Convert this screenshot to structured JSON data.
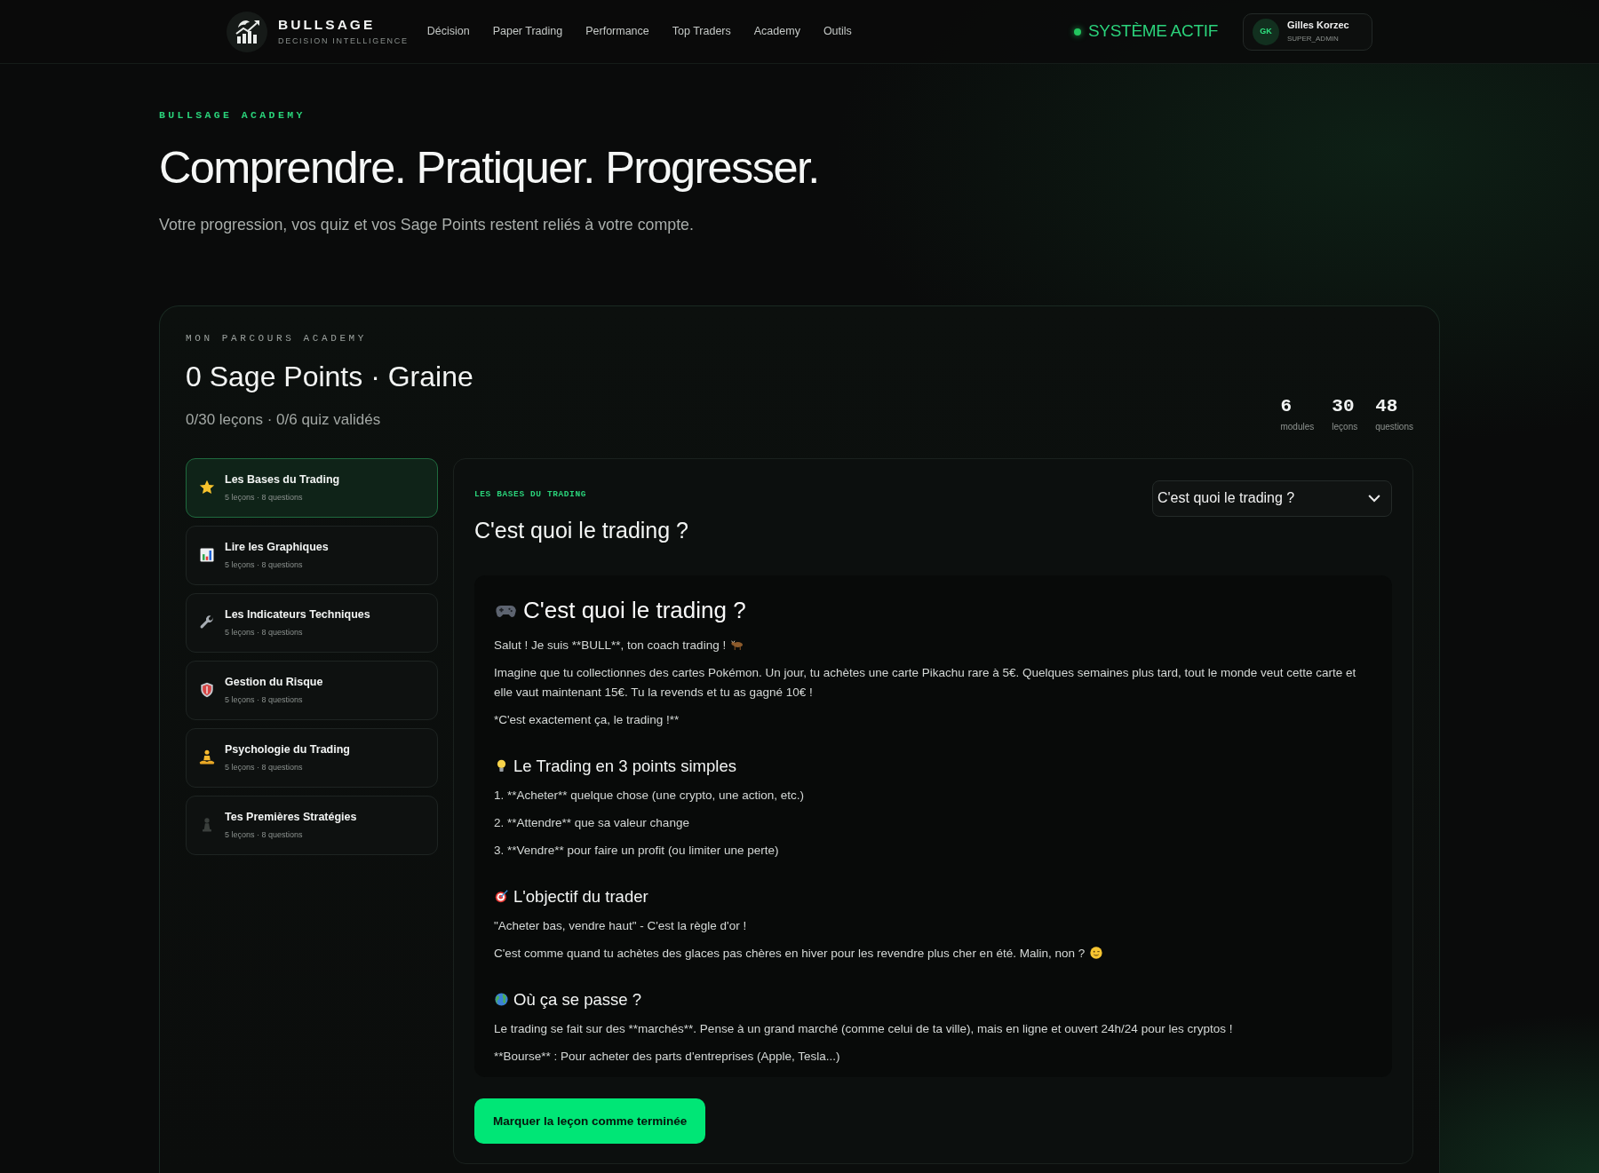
{
  "header": {
    "brand": {
      "name": "BULLSAGE",
      "tagline": "DECISION INTELLIGENCE"
    },
    "nav": [
      "Décision",
      "Paper Trading",
      "Performance",
      "Top Traders",
      "Academy",
      "Outils"
    ],
    "system_status": "SYSTÈME ACTIF",
    "user": {
      "initials": "GK",
      "name": "Gilles Korzec",
      "role": "SUPER_ADMIN"
    }
  },
  "hero": {
    "eyebrow": "BULLSAGE ACADEMY",
    "title": "Comprendre. Pratiquer. Progresser.",
    "subtitle": "Votre progression, vos quiz et vos Sage Points restent reliés à votre compte."
  },
  "journey": {
    "eyebrow": "MON PARCOURS ACADEMY",
    "title": "0 Sage Points · Graine",
    "progress": "0/30 leçons · 0/6 quiz validés",
    "stats": [
      {
        "value": "6",
        "label": "modules"
      },
      {
        "value": "30",
        "label": "leçons"
      },
      {
        "value": "48",
        "label": "questions"
      }
    ],
    "modules": [
      {
        "title": "Les Bases du Trading",
        "meta": "5 leçons · 8 questions",
        "selected": true
      },
      {
        "title": "Lire les Graphiques",
        "meta": "5 leçons · 8 questions",
        "selected": false
      },
      {
        "title": "Les Indicateurs Techniques",
        "meta": "5 leçons · 8 questions",
        "selected": false
      },
      {
        "title": "Gestion du Risque",
        "meta": "5 leçons · 8 questions",
        "selected": false
      },
      {
        "title": "Psychologie du Trading",
        "meta": "5 leçons · 8 questions",
        "selected": false
      },
      {
        "title": "Tes Premières Stratégies",
        "meta": "5 leçons · 8 questions",
        "selected": false
      }
    ],
    "lesson": {
      "module_label": "LES BASES DU TRADING",
      "title": "C'est quoi le trading ?",
      "lesson_select": {
        "value": "C'est quoi le trading ?"
      },
      "content": {
        "heading": "C'est quoi le trading ?",
        "blocks": [
          {
            "kind": "paragraph",
            "text": "Salut ! Je suis **BULL**, ton coach trading !"
          },
          {
            "kind": "paragraph",
            "text": "Imagine que tu collectionnes des cartes Pokémon. Un jour, tu achètes une carte Pikachu rare à 5€. Quelques semaines plus tard, tout le monde veut cette carte et elle vaut maintenant 15€. Tu la revends et tu as gagné 10€ !"
          },
          {
            "kind": "paragraph",
            "text": "*C'est exactement ça, le trading !**"
          },
          {
            "kind": "heading",
            "text": "Le Trading en 3 points simples"
          },
          {
            "kind": "paragraph",
            "text": "1. **Acheter** quelque chose (une crypto, une action, etc.)"
          },
          {
            "kind": "paragraph",
            "text": "2. **Attendre** que sa valeur change"
          },
          {
            "kind": "paragraph",
            "text": "3. **Vendre** pour faire un profit (ou limiter une perte)"
          },
          {
            "kind": "heading",
            "text": "L'objectif du trader"
          },
          {
            "kind": "paragraph",
            "text": "\"Acheter bas, vendre haut\" - C'est la règle d'or !"
          },
          {
            "kind": "paragraph",
            "text": "C'est comme quand tu achètes des glaces pas chères en hiver pour les revendre plus cher en été. Malin, non ?"
          },
          {
            "kind": "heading",
            "text": "Où ça se passe ?"
          },
          {
            "kind": "paragraph",
            "text": "Le trading se fait sur des **marchés**. Pense à un grand marché (comme celui de ta ville), mais en ligne et ouvert 24h/24 pour les cryptos !"
          },
          {
            "kind": "paragraph",
            "text": "**Bourse** : Pour acheter des parts d'entreprises (Apple, Tesla...)"
          }
        ]
      },
      "complete_button": "Marquer la leçon comme terminée"
    }
  }
}
